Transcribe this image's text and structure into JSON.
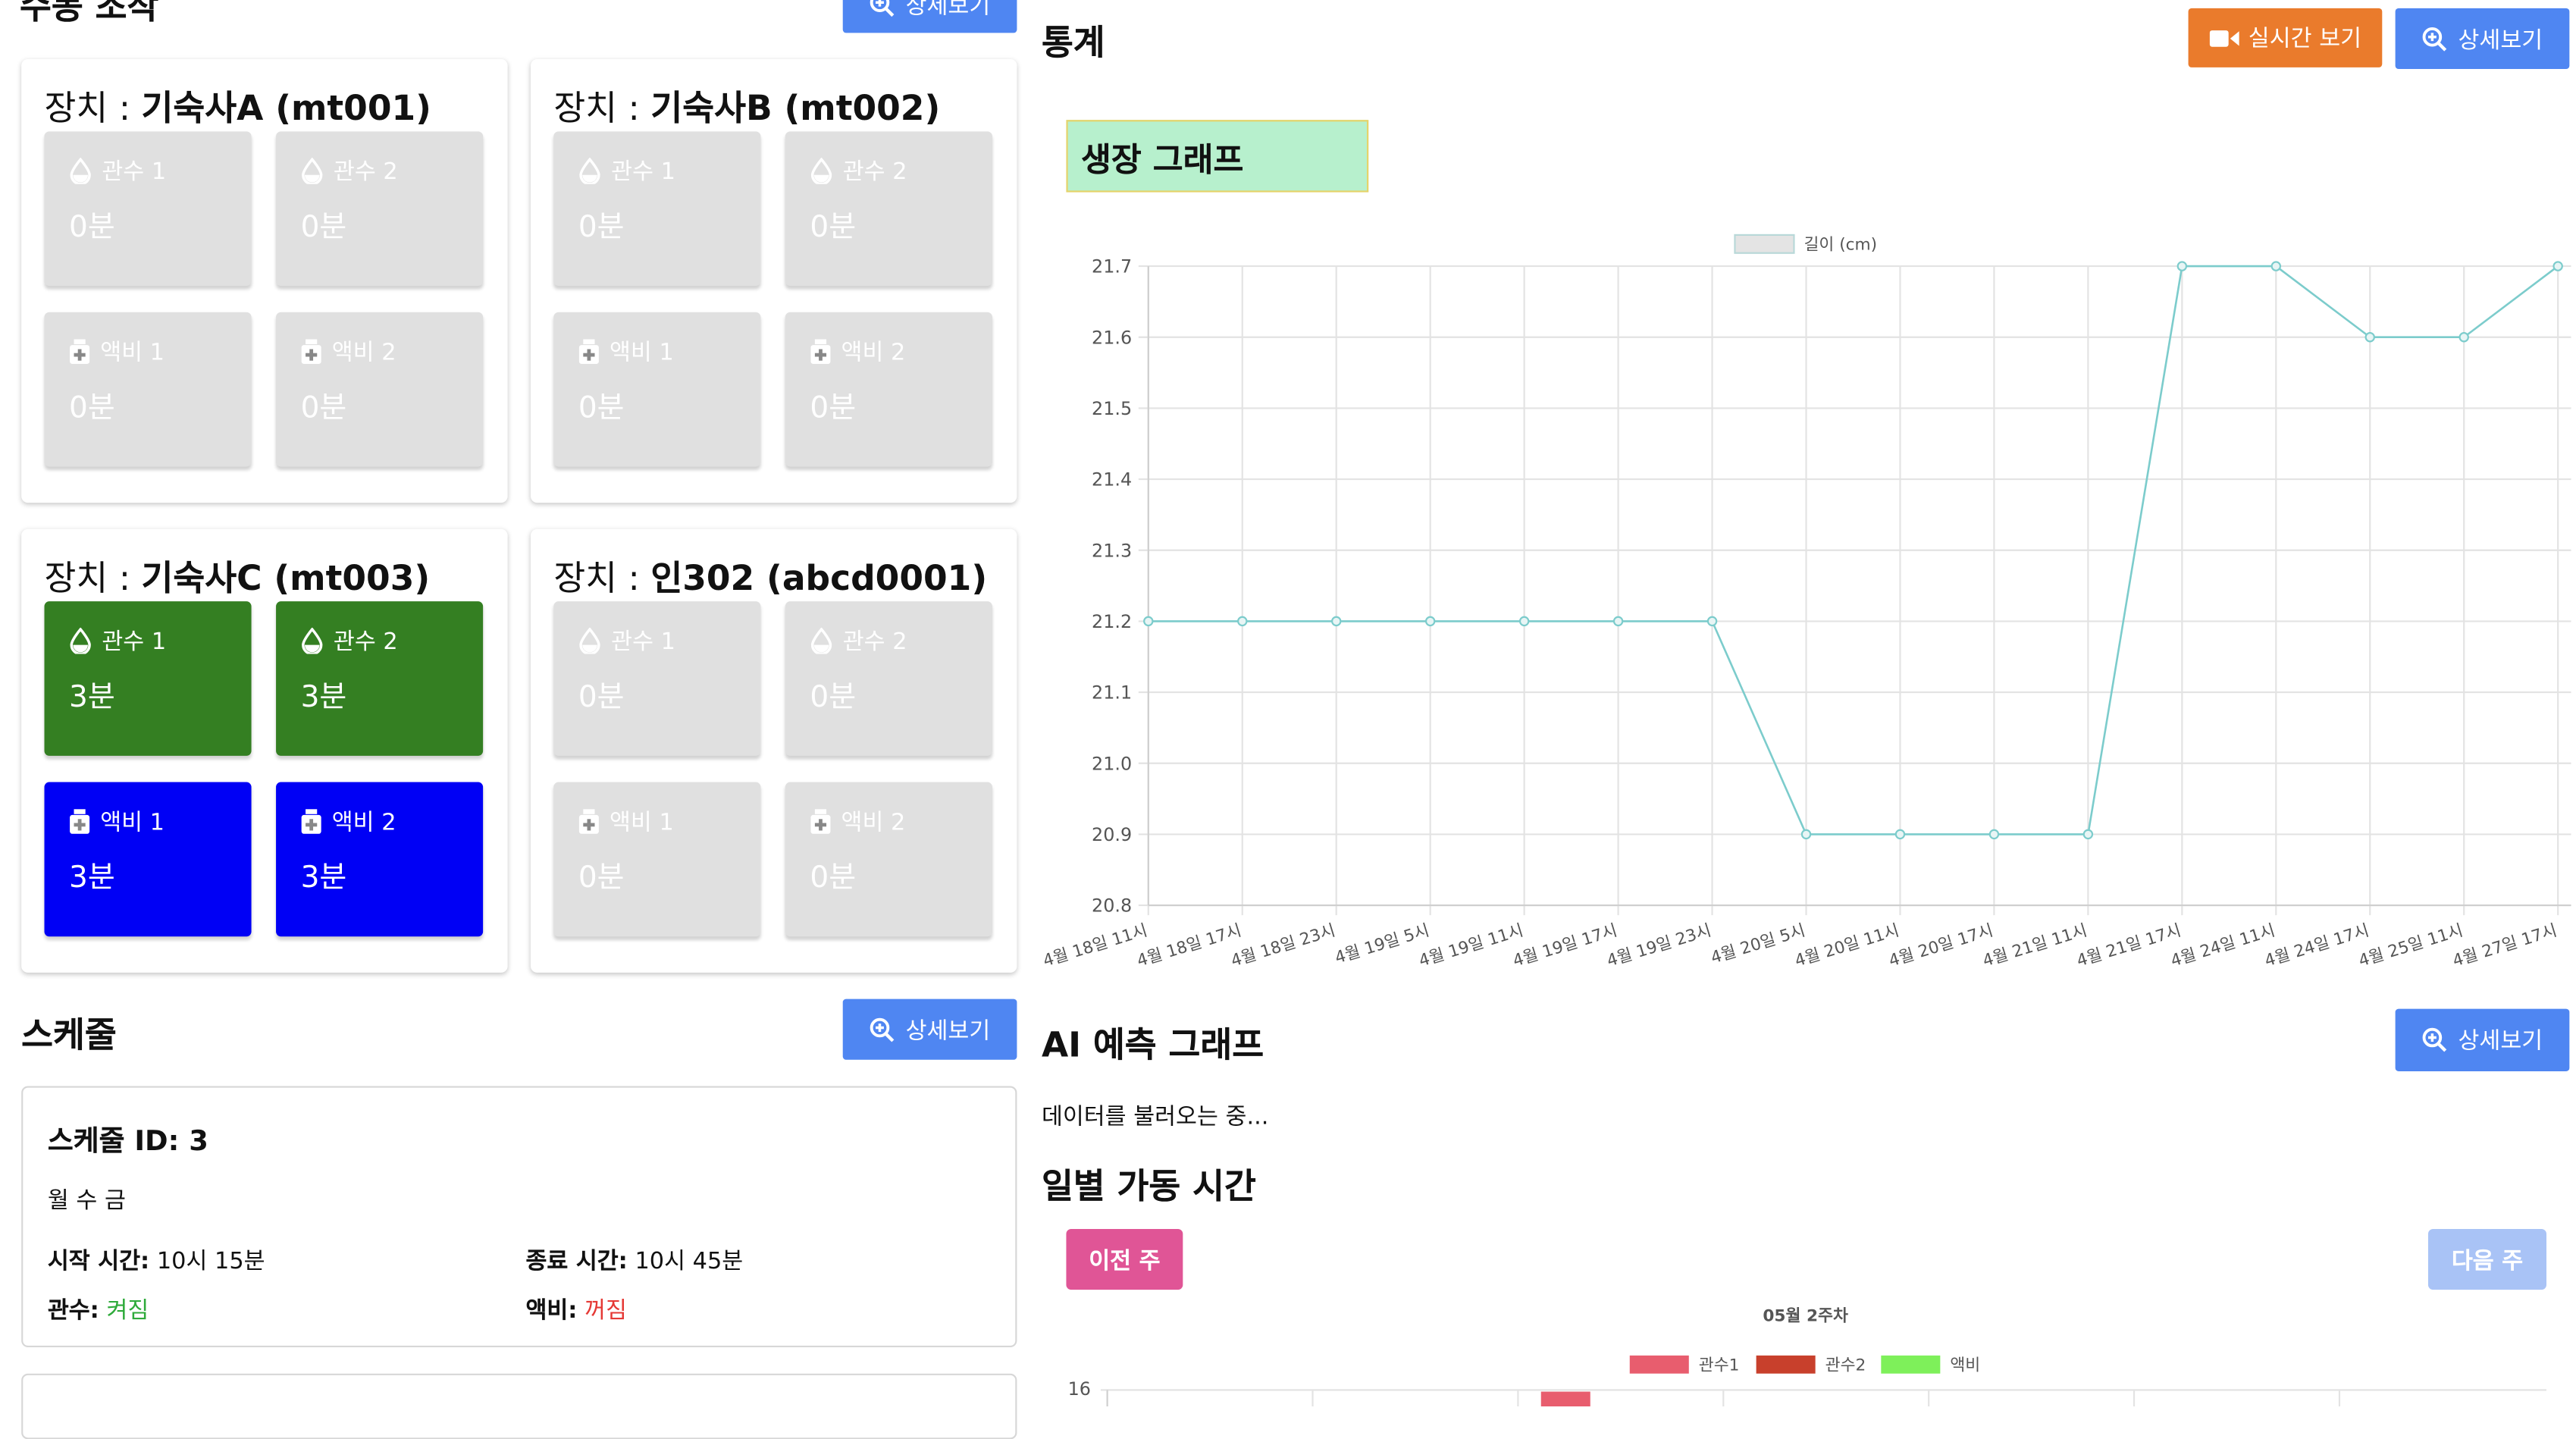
{
  "sections": {
    "control_title": "수동 조작",
    "stats_title": "통계",
    "schedule_title": "스케줄",
    "ai_title": "AI 예측 그래프",
    "daily_title": "일별 가동 시간"
  },
  "buttons": {
    "detail": "상세보기",
    "live": "실시간 보기",
    "prev_week": "이전 주",
    "next_week": "다음 주"
  },
  "devices": [
    {
      "prefix": "장치 : ",
      "name": "기숙사A (mt001)",
      "tiles": [
        {
          "label": "관수 1",
          "value": "0분",
          "state": "off",
          "icon": "droplet-icon"
        },
        {
          "label": "관수 2",
          "value": "0분",
          "state": "off",
          "icon": "droplet-icon"
        },
        {
          "label": "액비 1",
          "value": "0분",
          "state": "off",
          "icon": "nutrient-bottle-icon"
        },
        {
          "label": "액비 2",
          "value": "0분",
          "state": "off",
          "icon": "nutrient-bottle-icon"
        }
      ]
    },
    {
      "prefix": "장치 : ",
      "name": "기숙사B (mt002)",
      "tiles": [
        {
          "label": "관수 1",
          "value": "0분",
          "state": "off",
          "icon": "droplet-icon"
        },
        {
          "label": "관수 2",
          "value": "0분",
          "state": "off",
          "icon": "droplet-icon"
        },
        {
          "label": "액비 1",
          "value": "0분",
          "state": "off",
          "icon": "nutrient-bottle-icon"
        },
        {
          "label": "액비 2",
          "value": "0분",
          "state": "off",
          "icon": "nutrient-bottle-icon"
        }
      ]
    },
    {
      "prefix": "장치 : ",
      "name": "기숙사C (mt003)",
      "tiles": [
        {
          "label": "관수 1",
          "value": "3분",
          "state": "on-green",
          "icon": "droplet-icon"
        },
        {
          "label": "관수 2",
          "value": "3분",
          "state": "on-green",
          "icon": "droplet-icon"
        },
        {
          "label": "액비 1",
          "value": "3분",
          "state": "on-blue",
          "icon": "nutrient-bottle-icon"
        },
        {
          "label": "액비 2",
          "value": "3분",
          "state": "on-blue",
          "icon": "nutrient-bottle-icon"
        }
      ]
    },
    {
      "prefix": "장치 : ",
      "name": "인302 (abcd0001)",
      "tiles": [
        {
          "label": "관수 1",
          "value": "0분",
          "state": "off",
          "icon": "droplet-icon"
        },
        {
          "label": "관수 2",
          "value": "0분",
          "state": "off",
          "icon": "droplet-icon"
        },
        {
          "label": "액비 1",
          "value": "0분",
          "state": "off",
          "icon": "nutrient-bottle-icon"
        },
        {
          "label": "액비 2",
          "value": "0분",
          "state": "off",
          "icon": "nutrient-bottle-icon"
        }
      ]
    }
  ],
  "schedule": {
    "id_label": "스케줄 ID: 3",
    "days": "월 수 금",
    "start_label": "시작 시간:",
    "start_value": "10시 15분",
    "end_label": "종료 시간:",
    "end_value": "10시 45분",
    "irrigation_label": "관수:",
    "irrigation_value": "켜짐",
    "nutrient_label": "액비:",
    "nutrient_value": "꺼짐"
  },
  "ai": {
    "loading_text": "데이터를 불러오는 중..."
  },
  "colors": {
    "primary_blue": "#4f86f2",
    "live_orange": "#ea7b2c",
    "active_green": "#347f22",
    "active_blue": "#0000f5",
    "inactive_gray": "#e0e0e0",
    "prev_pink": "#e05596",
    "on_text": "#2eaa3a",
    "off_text": "#e53935",
    "growth_line": "#7ccccc"
  },
  "chart_data": [
    {
      "type": "line",
      "title": "생장 그래프",
      "legend": "길이 (cm)",
      "legend_position": "top-center",
      "grid": true,
      "categories": [
        "4월 18일 11시",
        "4월 18일 17시",
        "4월 18일 23시",
        "4월 19일 5시",
        "4월 19일 11시",
        "4월 19일 17시",
        "4월 19일 23시",
        "4월 20일 5시",
        "4월 20일 11시",
        "4월 20일 17시",
        "4월 21일 11시",
        "4월 21일 17시",
        "4월 24일 11시",
        "4월 24일 17시",
        "4월 25일 11시",
        "4월 27일 17시"
      ],
      "series": [
        {
          "name": "길이 (cm)",
          "values": [
            21.2,
            21.2,
            21.2,
            21.2,
            21.2,
            21.2,
            21.2,
            20.9,
            20.9,
            20.9,
            20.9,
            21.7,
            21.7,
            21.6,
            21.6,
            21.7
          ]
        }
      ],
      "ylim": [
        20.8,
        21.7
      ],
      "yticks": [
        "21.7",
        "21.6",
        "21.5",
        "21.4",
        "21.3",
        "21.2",
        "21.1",
        "21.0",
        "20.9",
        "20.8"
      ]
    },
    {
      "type": "bar",
      "title": "05월 2주차",
      "legend_position": "top-center",
      "series": [
        {
          "name": "관수1",
          "color": "#e85d6e"
        },
        {
          "name": "관수2",
          "color": "#c8402c"
        },
        {
          "name": "액비",
          "color": "#7ef05a"
        }
      ],
      "visible_ytick": "16"
    }
  ]
}
